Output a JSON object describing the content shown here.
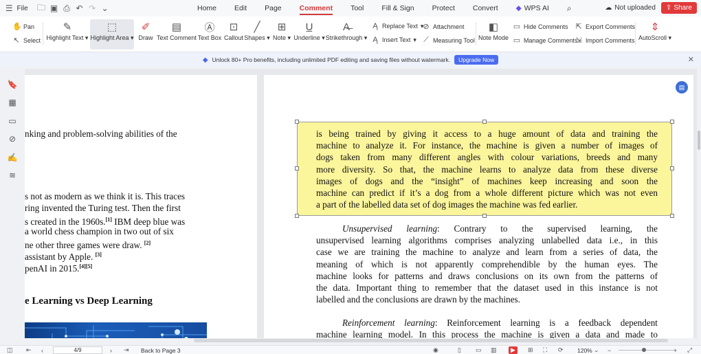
{
  "menubar": {
    "file_label": "File",
    "tabs": [
      "Home",
      "Edit",
      "Page",
      "Comment",
      "Tool",
      "Fill & Sign",
      "Protect",
      "Convert",
      "WPS AI"
    ],
    "active_tab": "Comment",
    "upload_status": "Not uploaded",
    "share_label": "Share"
  },
  "ribbon": {
    "pan": "Pan",
    "select": "Select",
    "highlight_text": "Highlight Text",
    "highlight_area": "Highlight Area",
    "draw": "Draw",
    "text_comment": "Text Comment",
    "text_box": "Text Box",
    "callout": "Callout",
    "shapes": "Shapes",
    "note": "Note",
    "underline": "Underline",
    "strikethrough": "Strikethrough",
    "replace_text": "Replace Text",
    "insert_text": "Insert Text",
    "attachment": "Attachment",
    "measuring_tool": "Measuring Tool",
    "note_mode": "Note Mode",
    "hide_comments": "Hide Comments",
    "manage_comments": "Manage Comments",
    "export_comments": "Export Comments",
    "import_comments": "Import Comments",
    "autoscroll": "AutoScroll"
  },
  "promo": {
    "text": "Unlock 80+ Pro benefits, including unlimited PDF editing and saving files without watermark.",
    "button": "Upgrade Now"
  },
  "left_page": {
    "lines": [
      "nking and problem-solving abilities of the",
      "s not as modern as we think it is. This traces",
      "ring invented the Turing test. Then the first",
      "s created in the 1960s.",
      "IBM deep blue was",
      "a world chess champion in two out of six",
      "ne other three games were draw.",
      "assistant by Apple.",
      "penAI in 2015."
    ],
    "refs": [
      "[1]",
      "[2]",
      "[3]",
      "[4][5]"
    ],
    "heading": "e Learning vs Deep Learning"
  },
  "right_page": {
    "highlight_lines": [
      "is being trained by giving it access to a huge amount of data and training the",
      "machine to analyze it. For instance, the machine is given a number of images of",
      "dogs taken from many different angles with colour variations, breeds and many",
      "more diversity. So that, the machine learns to analyze data from these diverse",
      "images of dogs and the “insight” of machines keep increasing and soon the",
      "machine can predict if it’s a dog from a whole different picture which was not even",
      "a part of the labelled data set of dog images the machine was fed earlier."
    ],
    "unsup_term": "Unsupervised learning",
    "unsup_first": ": Contrary to the supervised learning, the",
    "unsup_lines": [
      "unsupervised learning algorithms comprises analyzing unlabelled data i.e., in this",
      "case we are training the machine to analyze and learn from a series of data, the",
      "meaning of which is not apparently comprehendible by the human eyes. The",
      "machine looks for patterns and draws conclusions on its own from the patterns of",
      "the data. Important thing to remember that the dataset used in this instance is not",
      "labelled and the conclusions are drawn by the machines."
    ],
    "reinf_term": "Reinforcement learning",
    "reinf_first": ": Reinforcement learning is a feedback dependent",
    "reinf_line2": "machine learning model. In this process the machine is given a data and made to"
  },
  "statusbar": {
    "page_value": "4/9",
    "back_to_page": "Back to Page 3",
    "zoom": "120%"
  }
}
